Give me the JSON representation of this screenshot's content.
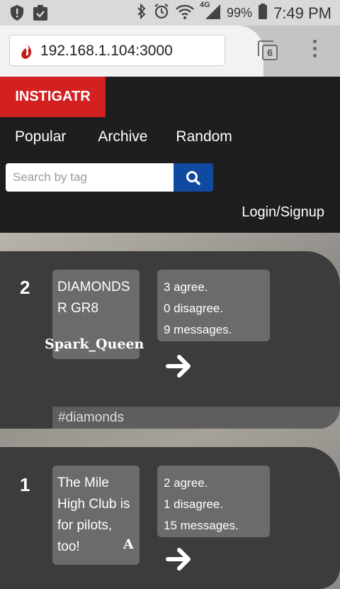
{
  "status_bar": {
    "battery_pct": "99%",
    "time": "7:49 PM",
    "network": "4G"
  },
  "browser": {
    "url": "192.168.1.104:3000",
    "tab_count": "6"
  },
  "site": {
    "logo": "INSTIGATR",
    "nav": [
      "Popular",
      "Archive",
      "Random"
    ],
    "search_placeholder": "Search by tag",
    "login": "Login/Signup"
  },
  "posts": [
    {
      "rank": "2",
      "text": "DIAMONDS R GR8",
      "author": "Spark_Queen",
      "agree": "3 agree.",
      "disagree": "0 disagree.",
      "messages": "9 messages.",
      "tag": "#diamonds"
    },
    {
      "rank": "1",
      "text": "The Mile High Club is for pilots, too!",
      "author": "A",
      "agree": "2 agree.",
      "disagree": "1 disagree.",
      "messages": "15 messages."
    }
  ],
  "colors": {
    "logo_bg": "#d32020",
    "header_bg": "#1e1e1e",
    "search_btn": "#0f4aa0",
    "card_bg": "#3c3c3c",
    "box_bg": "#6b6b6b"
  }
}
